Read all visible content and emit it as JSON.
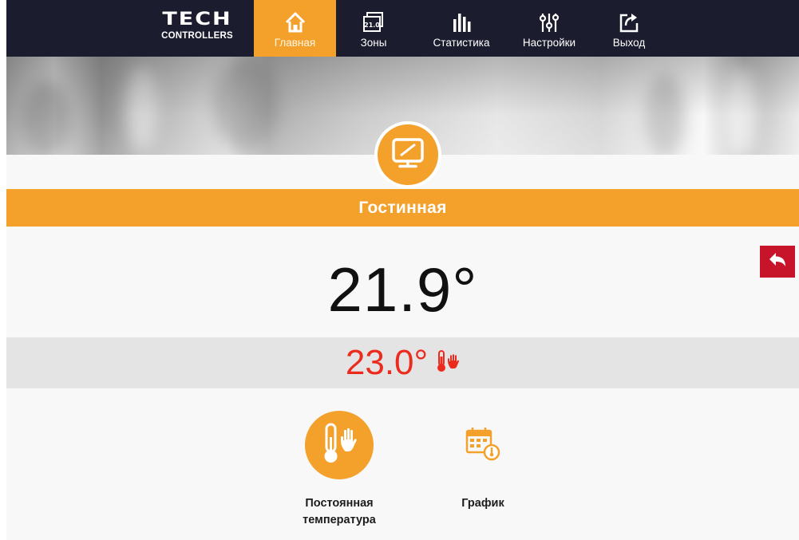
{
  "header": {
    "logo": {
      "line1": "TECH",
      "line2": "CONTROLLERS"
    },
    "nav": [
      {
        "label": "Главная",
        "icon": "home-icon",
        "active": true
      },
      {
        "label": "Зоны",
        "icon": "zones-icon",
        "badge": "21.0",
        "active": false
      },
      {
        "label": "Статистика",
        "icon": "statistics-icon",
        "active": false
      },
      {
        "label": "Настройки",
        "icon": "settings-sliders-icon",
        "active": false
      },
      {
        "label": "Выход",
        "icon": "logout-icon",
        "active": false
      }
    ]
  },
  "zone": {
    "icon": "thermostat-panel-icon",
    "name": "Гостинная",
    "current_temperature": "21.9°",
    "setpoint_temperature": "23.0°",
    "setpoint_mode_icons": [
      "thermometer-icon",
      "hand-icon"
    ]
  },
  "modes": [
    {
      "label_line1": "Постоянная",
      "label_line2": "температура",
      "icon": "constant-temperature-icon",
      "selected": true
    },
    {
      "label_line1": "График",
      "label_line2": "",
      "icon": "schedule-calendar-icon",
      "selected": false
    }
  ],
  "colors": {
    "accent": "#f3a12b",
    "topbar": "#1b1c2e",
    "back_button": "#c8142a",
    "setpoint": "#ec2b1f",
    "setpoint_bar": "#e4e4e4"
  }
}
